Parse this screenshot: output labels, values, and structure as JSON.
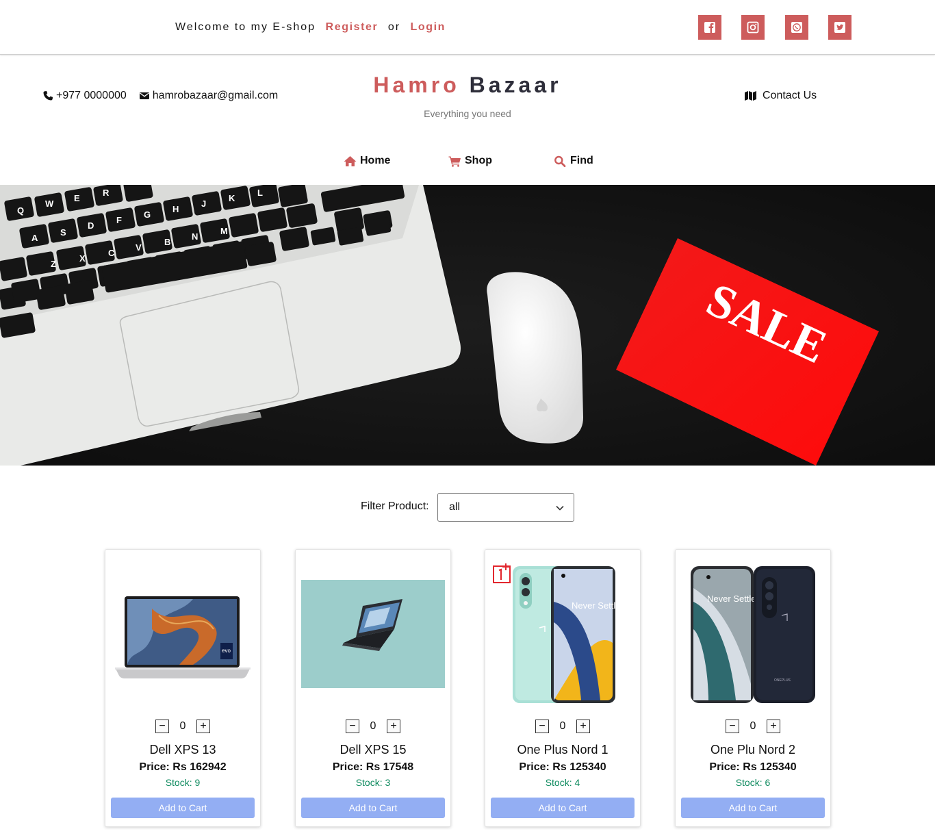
{
  "topbar": {
    "welcome_text": "Welcome to my E-shop",
    "register_label": "Register",
    "or_text": "or",
    "login_label": "Login",
    "social": [
      {
        "icon": "facebook-icon"
      },
      {
        "icon": "instagram-icon"
      },
      {
        "icon": "whatsapp-icon"
      },
      {
        "icon": "twitter-icon"
      }
    ]
  },
  "header": {
    "phone": "+977 0000000",
    "email": "hamrobazaar@gmail.com",
    "brand_first": "Hamro",
    "brand_second": "Bazaar",
    "tagline": "Everything you need",
    "contact_label": "Contact Us"
  },
  "nav": {
    "home": "Home",
    "shop": "Shop",
    "find": "Find"
  },
  "hero": {
    "sale_text": "SALE"
  },
  "filter": {
    "label": "Filter Product:",
    "selected": "all"
  },
  "products": [
    {
      "name": "Dell XPS 13",
      "price": "Price: Rs 162942",
      "stock": "Stock: 9",
      "qty": "0",
      "add_label": "Add to Cart"
    },
    {
      "name": "Dell XPS 15",
      "price": "Price: Rs 17548",
      "stock": "Stock: 3",
      "qty": "0",
      "add_label": "Add to Cart"
    },
    {
      "name": "One Plus Nord 1",
      "price": "Price: Rs 125340",
      "stock": "Stock: 4",
      "qty": "0",
      "add_label": "Add to Cart"
    },
    {
      "name": "One Plu Nord 2",
      "price": "Price: Rs 125340",
      "stock": "Stock: 6",
      "qty": "0",
      "add_label": "Add to Cart"
    }
  ],
  "product_images": {
    "p3_tagline": "Never Settle",
    "p4_tagline": "Never Settle",
    "p4_brand": "ONEPLUS",
    "evo_badge": "evo"
  },
  "colors": {
    "accent": "#cd5c5c",
    "dark": "#2e2e3a",
    "button": "#93aef3",
    "stock": "#0e8a5f"
  }
}
